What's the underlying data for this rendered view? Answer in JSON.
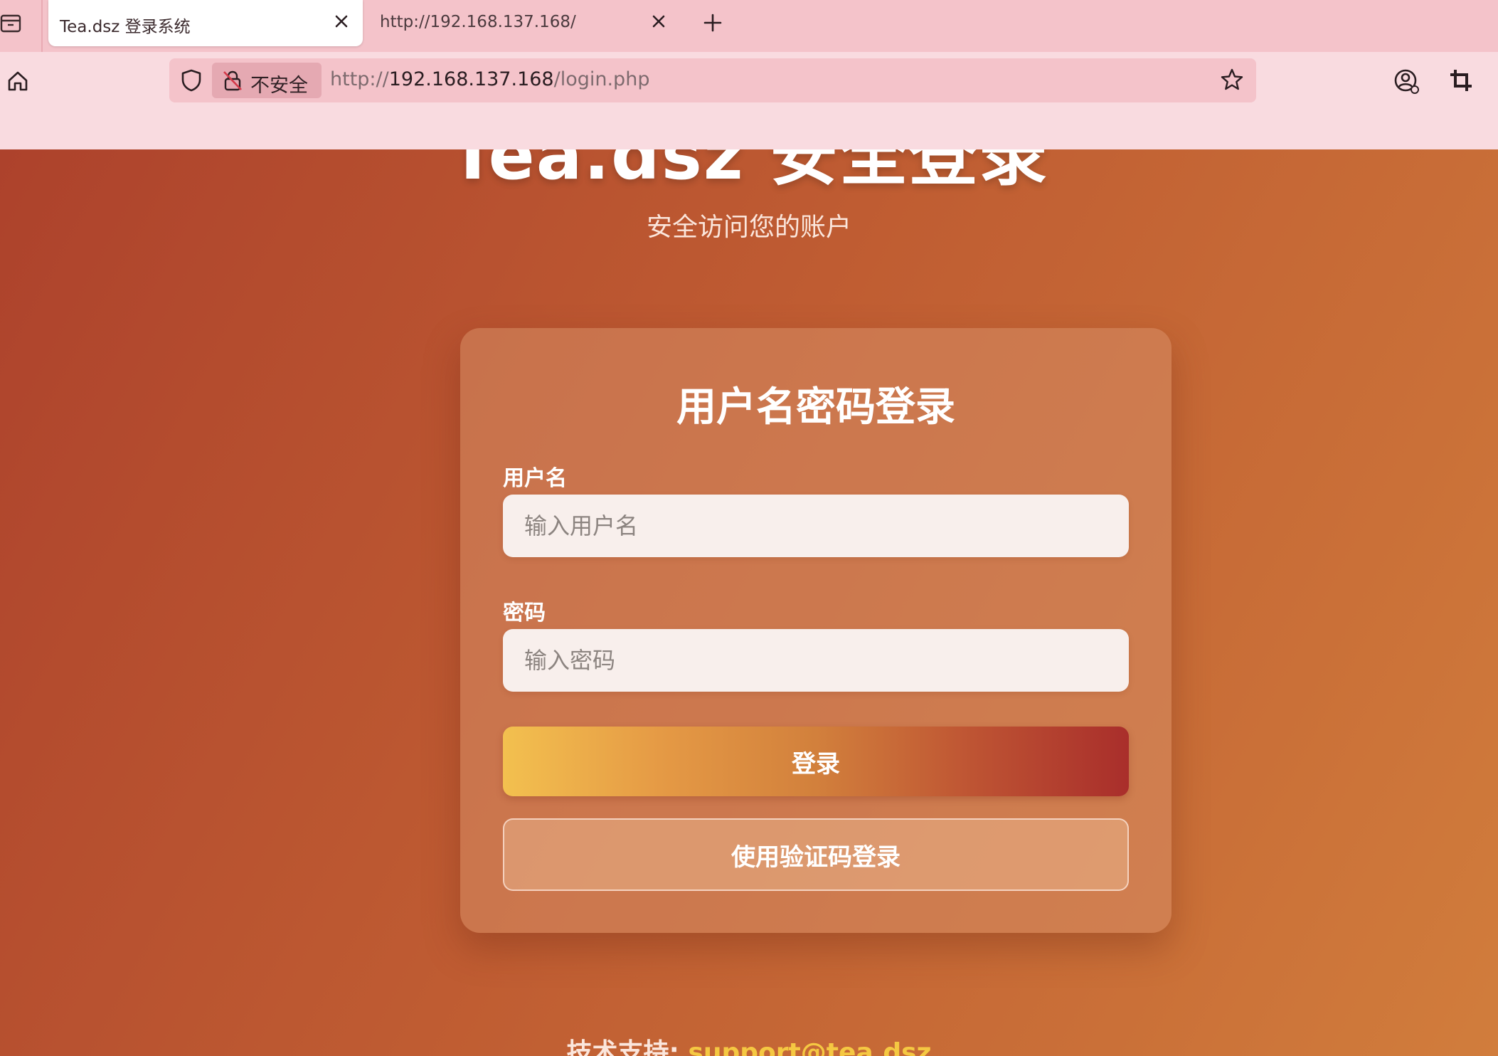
{
  "browser": {
    "tabs": [
      {
        "title": "Tea.dsz 登录系统",
        "active": true
      },
      {
        "title": "http://192.168.137.168/",
        "active": false
      }
    ],
    "url": {
      "security_label": "不安全",
      "scheme": "http://",
      "host": "192.168.137.168",
      "path": "/login.php"
    },
    "icons": [
      "tab-overview-icon",
      "close-icon",
      "plus-icon",
      "home-icon",
      "shield-icon",
      "insecure-lock-icon",
      "star-icon",
      "account-icon",
      "crop-icon"
    ]
  },
  "page": {
    "title": "Tea.dsz 安全登录",
    "subtitle": "安全访问您的账户",
    "login_card": {
      "title": "用户名密码登录",
      "username_label": "用户名",
      "username_placeholder": "输入用户名",
      "password_label": "密码",
      "password_placeholder": "输入密码",
      "login_button": "登录",
      "code_login_button": "使用验证码登录"
    },
    "footer": {
      "label": "技术支持: ",
      "email": "support@tea.dsz"
    }
  },
  "colors": {
    "tabbar": "#f4c3ca",
    "toolbar": "#f9dbe0",
    "accent_gold": "#f5c842",
    "gradient_start": "#f3c04f",
    "gradient_end": "#a92e2b"
  }
}
